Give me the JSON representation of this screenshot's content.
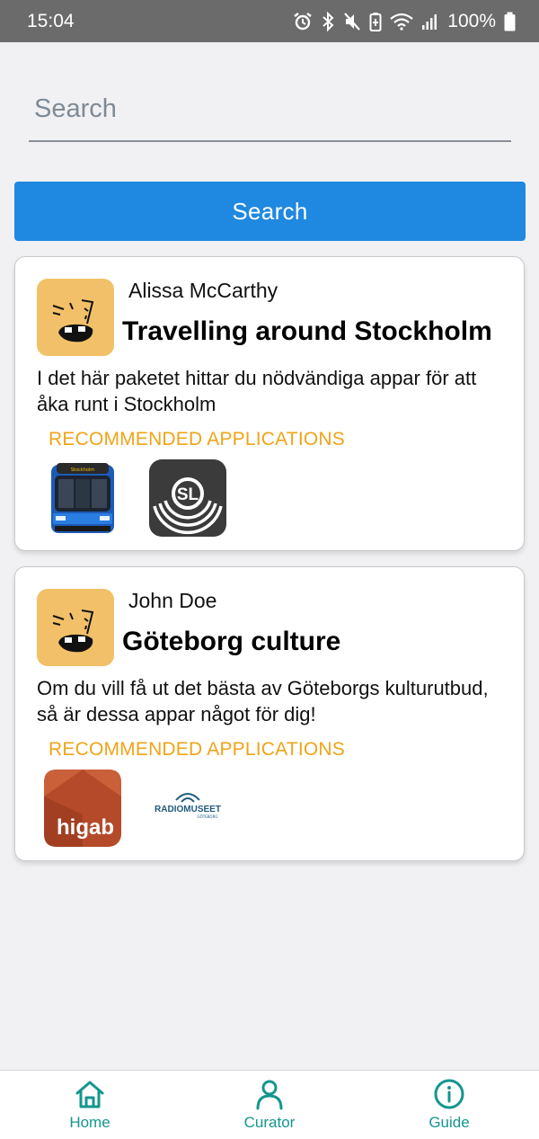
{
  "status_bar": {
    "time": "15:04",
    "battery": "100%",
    "icons": [
      "alarm-icon",
      "bluetooth-icon",
      "mute-icon",
      "battery-saver-icon",
      "wifi-icon",
      "signal-icon",
      "battery-icon"
    ]
  },
  "search": {
    "placeholder": "Search",
    "value": "",
    "button_label": "Search"
  },
  "packages": [
    {
      "curator": "Alissa McCarthy",
      "title": "Travelling around Stockholm",
      "description": "I det här paketet hittar du nödvändiga appar för att åka runt i Stockholm",
      "apps_label": "RECOMMENDED APPLICATIONS",
      "apps": [
        {
          "icon": "metro-train-app-icon",
          "label": "Stockholm"
        },
        {
          "icon": "sl-app-icon",
          "label": "SL"
        }
      ]
    },
    {
      "curator": "John Doe",
      "title": "Göteborg culture",
      "description": "Om du vill få ut det bästa av Göteborgs kulturutbud, så är dessa appar något för dig!",
      "apps_label": "RECOMMENDED APPLICATIONS",
      "apps": [
        {
          "icon": "higab-app-icon",
          "label": "higab"
        },
        {
          "icon": "radiomuseet-app-icon",
          "label": "RADIOMUSEET",
          "sublabel": "GÖTEBORG"
        }
      ]
    }
  ],
  "bottom_nav": {
    "items": [
      {
        "label": "Home",
        "icon": "home-icon"
      },
      {
        "label": "Curator",
        "icon": "person-icon"
      },
      {
        "label": "Guide",
        "icon": "info-icon"
      }
    ]
  },
  "colors": {
    "accent": "#1f88e0",
    "recommended_label": "#f0a418",
    "nav": "#14968f",
    "avatar": "#f2c068"
  }
}
